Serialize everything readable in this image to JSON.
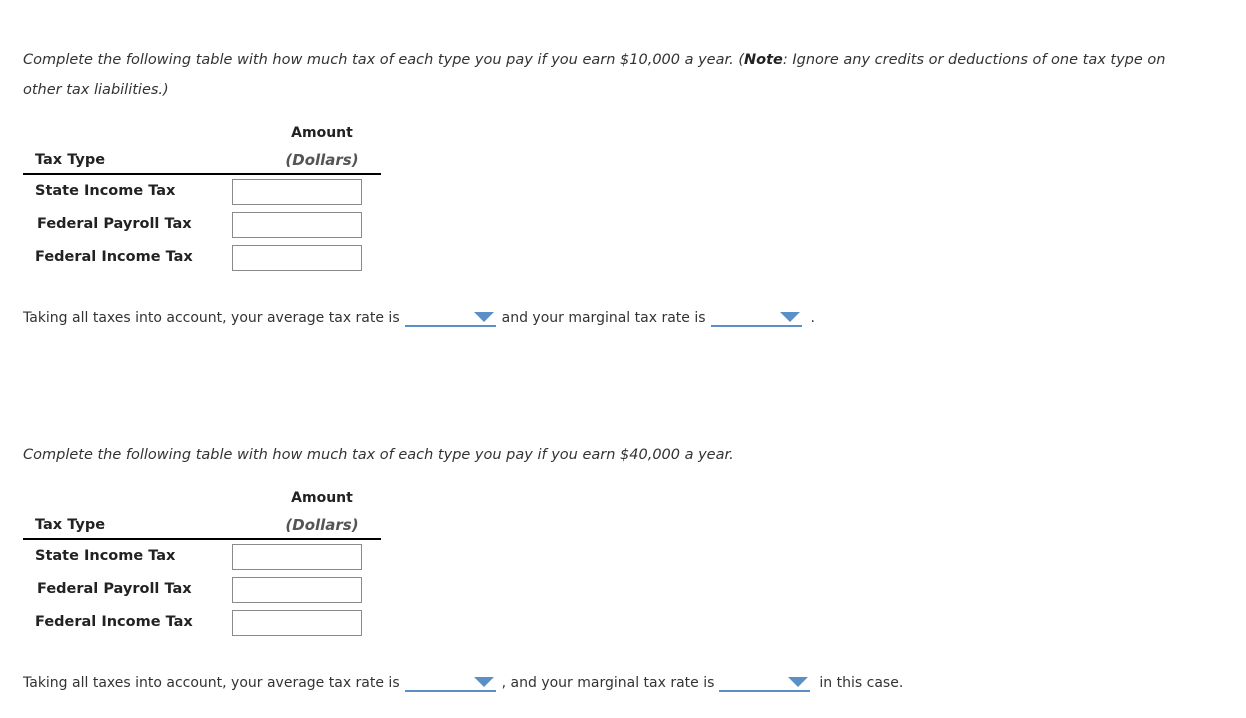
{
  "colors": {
    "dropdown_accent": "#5b8fc7",
    "text": "#333333"
  },
  "section1": {
    "prompt_part1": "Complete the following table with how much tax of each type you pay if you earn $10,000 a year. (",
    "prompt_note_label": "Note",
    "prompt_part2": ": Ignore any credits or deductions of one tax type on other tax liabilities.)",
    "table": {
      "col_amount": "Amount",
      "col_dollars": "(Dollars)",
      "col_type": "Tax Type",
      "rows": [
        {
          "label": "State Income Tax",
          "value": ""
        },
        {
          "label": "Federal Payroll Tax",
          "value": ""
        },
        {
          "label": "Federal Income Tax",
          "value": ""
        }
      ]
    },
    "sentence": {
      "part1": "Taking all taxes into account, your average tax rate is",
      "average_selected": "",
      "part2": "and your marginal tax rate is",
      "marginal_selected": "",
      "part3": "."
    }
  },
  "section2": {
    "prompt": "Complete the following table with how much tax of each type you pay if you earn $40,000 a year.",
    "table": {
      "col_amount": "Amount",
      "col_dollars": "(Dollars)",
      "col_type": "Tax Type",
      "rows": [
        {
          "label": "State Income Tax",
          "value": ""
        },
        {
          "label": "Federal Payroll Tax",
          "value": ""
        },
        {
          "label": "Federal Income Tax",
          "value": ""
        }
      ]
    },
    "sentence": {
      "part1": "Taking all taxes into account, your average tax rate is",
      "average_selected": "",
      "part2": ", and your marginal tax rate is",
      "marginal_selected": "",
      "part3": "in this case."
    }
  }
}
